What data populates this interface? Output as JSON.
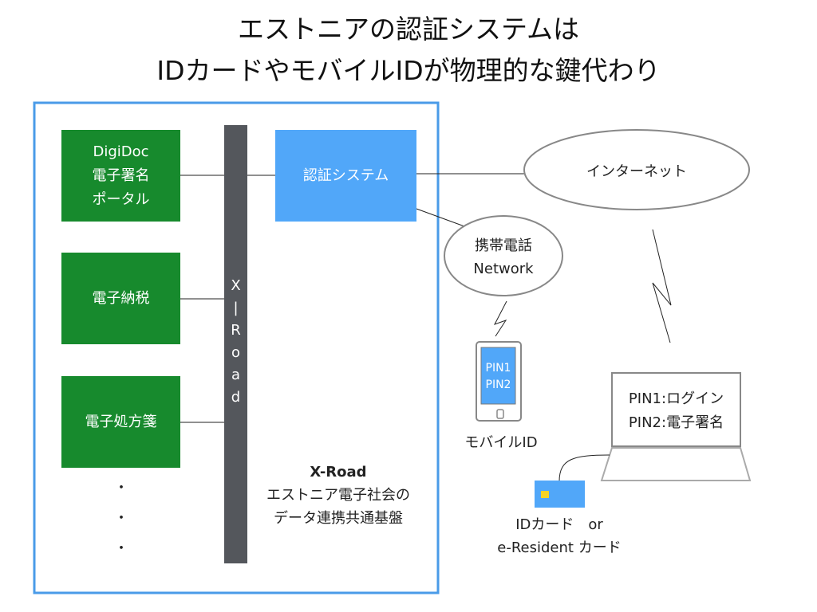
{
  "title": {
    "line1": "エストニアの認証システムは",
    "line2": "IDカードやモバイルIDが物理的な鍵代わり"
  },
  "services": [
    {
      "lines": [
        "DigiDoc",
        "電子署名",
        "ポータル"
      ]
    },
    {
      "lines": [
        "電子納税"
      ]
    },
    {
      "lines": [
        "電子処方箋"
      ]
    }
  ],
  "ellipsis_dots": [
    "・",
    "・",
    "・"
  ],
  "xroad_bar": {
    "letters": [
      "X",
      "|",
      "R",
      "o",
      "a",
      "d"
    ]
  },
  "xroad_caption": {
    "name": "X-Road",
    "line1": "エストニア電子社会の",
    "line2": "データ連携共通基盤"
  },
  "auth_system": "認証システム",
  "internet": "インターネット",
  "mobile_network": {
    "line1": "携帯電話",
    "line2": "Network"
  },
  "phone": {
    "screen_line1": "PIN1",
    "screen_line2": "PIN2",
    "caption": "モバイルID"
  },
  "laptop": {
    "line1": "PIN1:ログイン",
    "line2": "PIN2:電子署名"
  },
  "card": {
    "line1": "IDカード　or",
    "line2": "e-Resident カード"
  },
  "colors": {
    "service_green": "#178a2d",
    "auth_blue": "#51a7f9",
    "frame_blue": "#4a9be8",
    "xroad_gray": "#54575c",
    "chip_yellow": "#f5d327"
  }
}
